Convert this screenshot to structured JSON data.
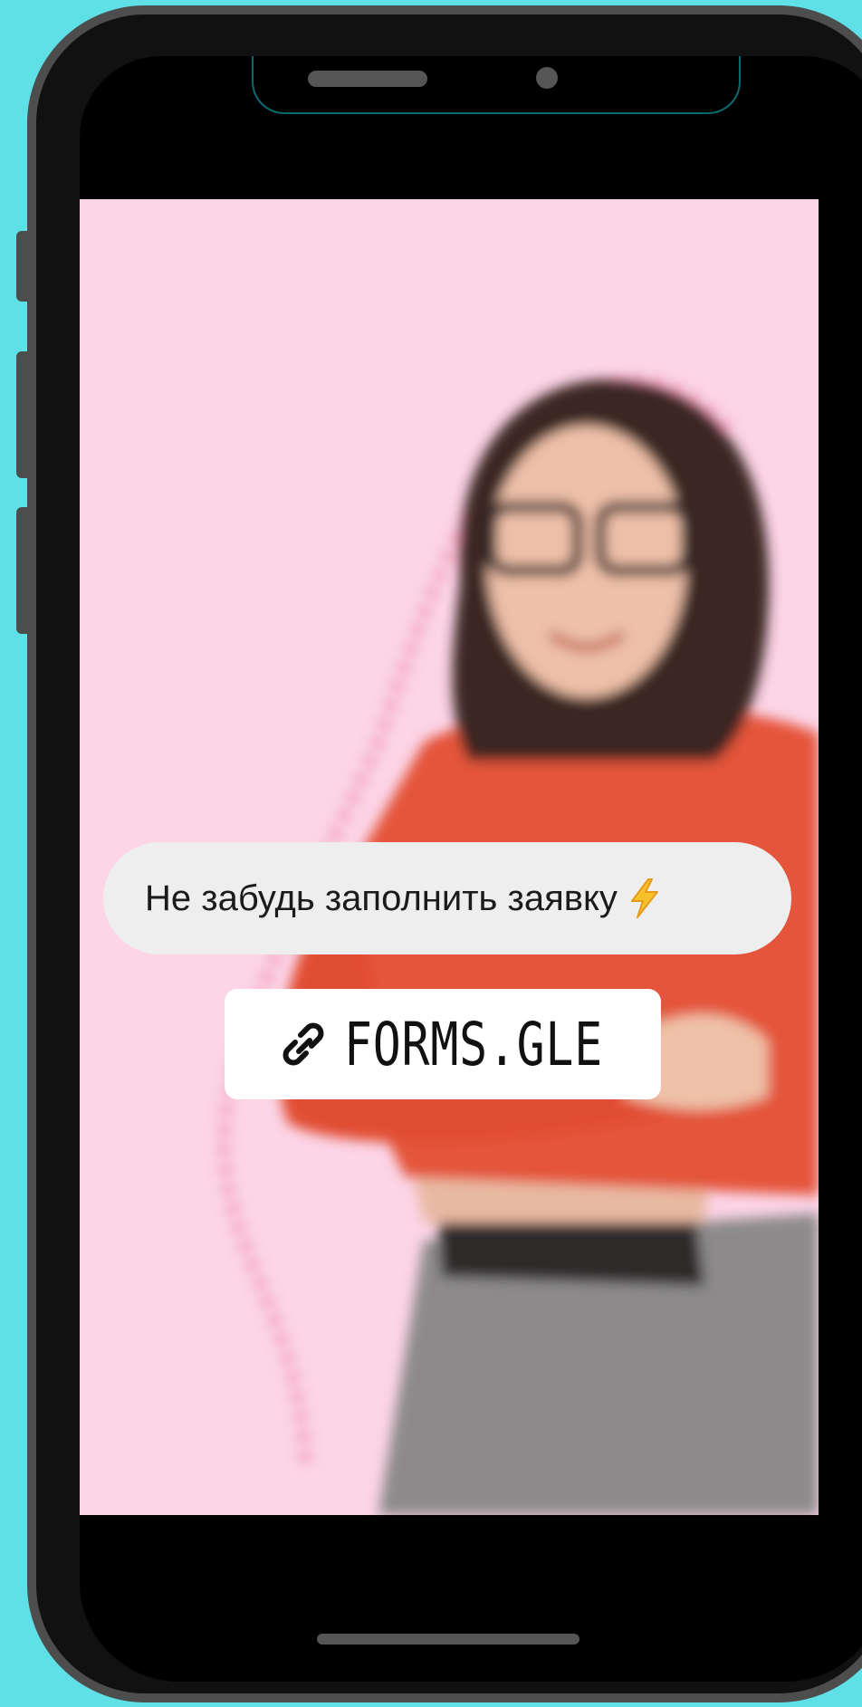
{
  "story": {
    "question_text": "Не забудь заполнить заявку",
    "link_text": "FORMS.GLE",
    "background_color": "#fcd5e7"
  },
  "icons": {
    "question_icon": "lightning-bolt-icon",
    "link_icon": "link-chain-icon"
  },
  "colors": {
    "page_background": "#5fe0e6",
    "phone_frame": "#4d4d4d",
    "sweater": "#e4553a"
  }
}
